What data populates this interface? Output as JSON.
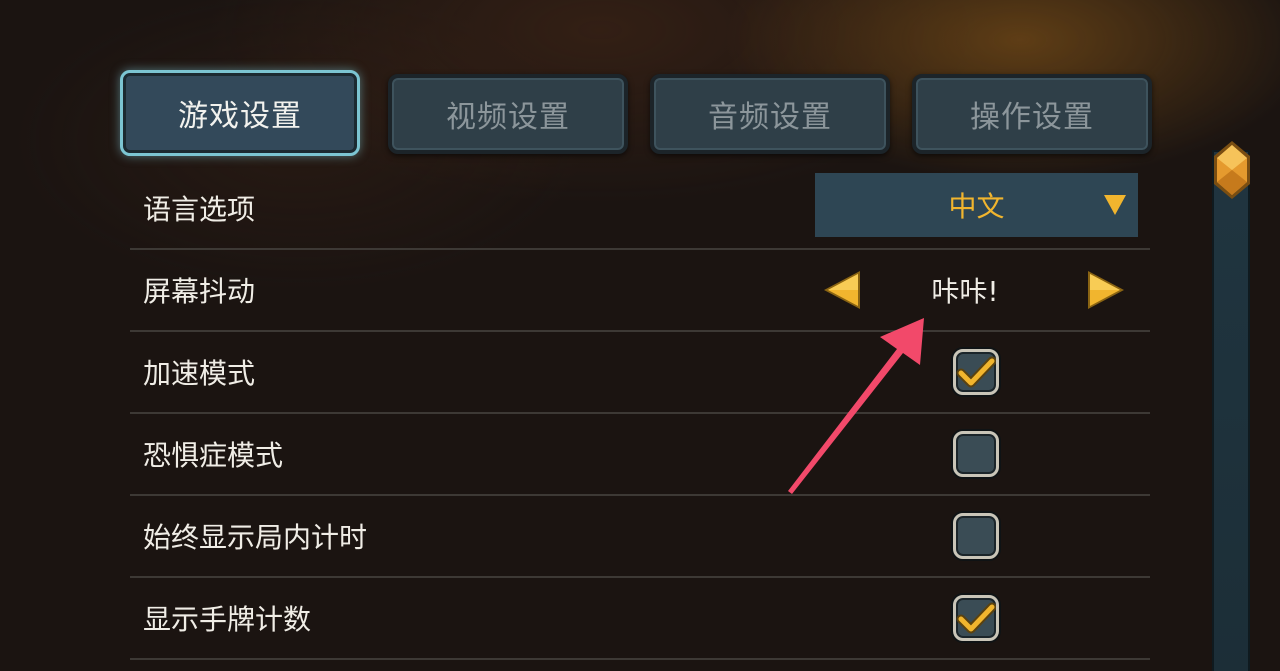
{
  "tabs": [
    {
      "label": "游戏设置",
      "active": true
    },
    {
      "label": "视频设置",
      "active": false
    },
    {
      "label": "音频设置",
      "active": false
    },
    {
      "label": "操作设置",
      "active": false
    }
  ],
  "settings": {
    "language": {
      "label": "语言选项",
      "value": "中文"
    },
    "screen_shake": {
      "label": "屏幕抖动",
      "value": "咔咔!"
    },
    "fast_mode": {
      "label": "加速模式",
      "checked": true
    },
    "arachnophobia_mode": {
      "label": "恐惧症模式",
      "checked": false
    },
    "show_timer": {
      "label": "始终显示局内计时",
      "checked": false
    },
    "show_hand_count": {
      "label": "显示手牌计数",
      "checked": true
    }
  },
  "colors": {
    "accent_gold": "#f1b52e",
    "active_tab_border": "#7cc5d2",
    "annotation_arrow": "#f2496a"
  },
  "icons": {
    "dropdown": "triangle-down-icon",
    "prev": "triangle-left-icon",
    "next": "triangle-right-icon",
    "check": "checkmark-icon",
    "scroll_thumb": "gem-icon"
  }
}
